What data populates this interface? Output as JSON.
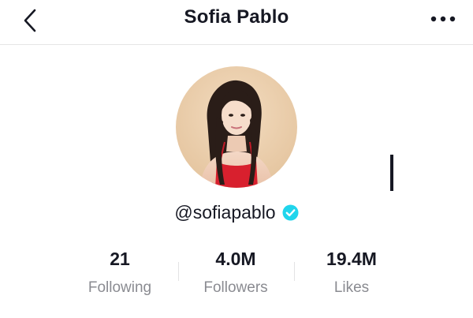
{
  "header": {
    "title": "Sofia Pablo",
    "back_icon": "chevron-left-icon",
    "more_icon": "more-horizontal-icon"
  },
  "profile": {
    "username": "@sofiapablo",
    "verified": true,
    "verified_color": "#20d5ec"
  },
  "stats": {
    "following": {
      "value": "21",
      "label": "Following"
    },
    "followers": {
      "value": "4.0M",
      "label": "Followers"
    },
    "likes": {
      "value": "19.4M",
      "label": "Likes"
    }
  }
}
